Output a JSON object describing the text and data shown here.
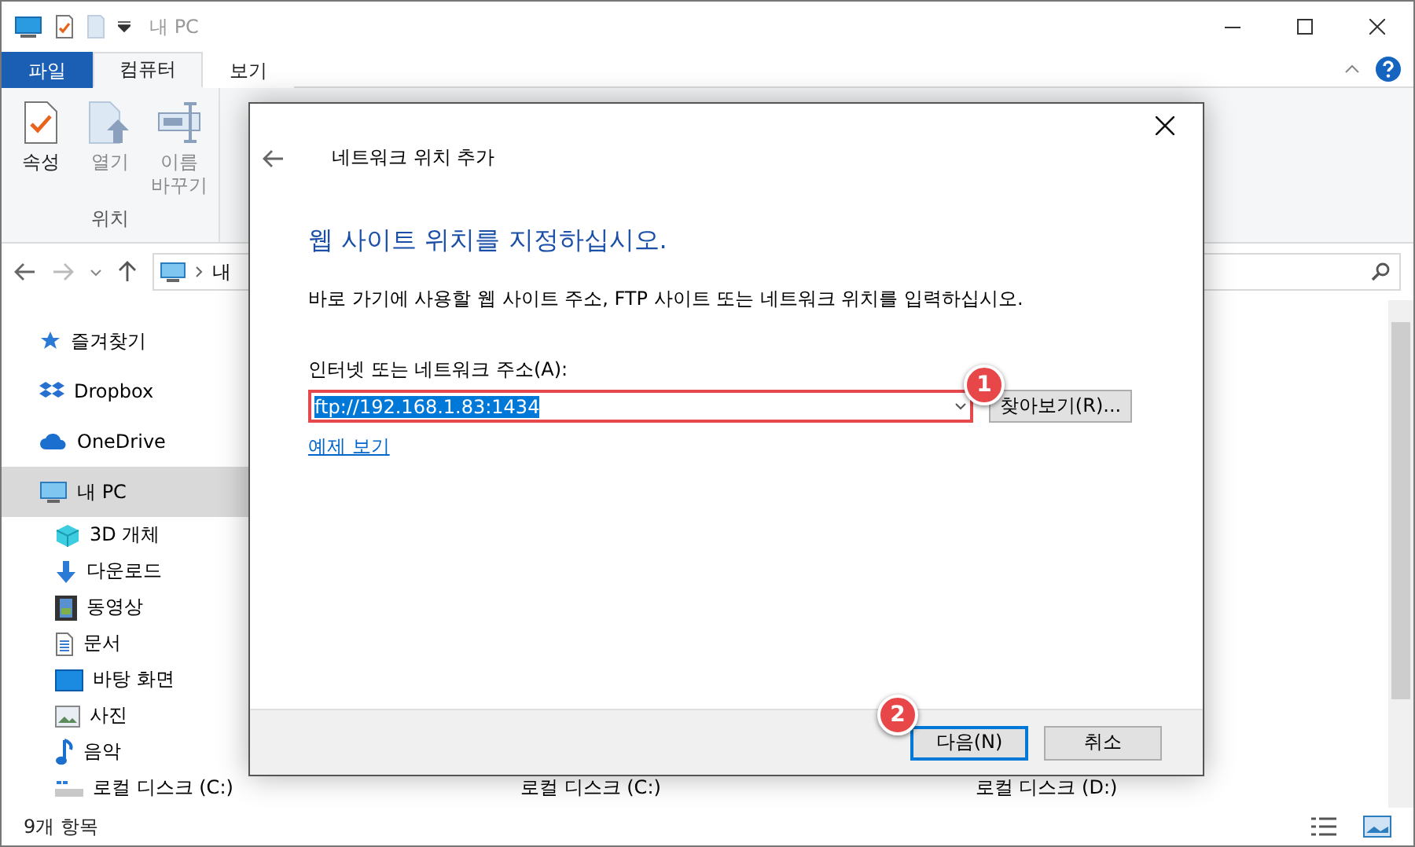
{
  "window": {
    "title": "내 PC"
  },
  "ribbon_tabs": [
    {
      "label": "파일",
      "kind": "file",
      "selected": false
    },
    {
      "label": "컴퓨터",
      "kind": "tab",
      "selected": true
    },
    {
      "label": "보기",
      "kind": "tab",
      "selected": false
    }
  ],
  "ribbon": {
    "buttons": [
      {
        "label": "속성",
        "disabled": false
      },
      {
        "label": "열기",
        "disabled": true
      },
      {
        "label": "이름 바꾸기",
        "disabled": true
      }
    ],
    "group_label": "위치"
  },
  "address_bar": {
    "crumb": "내"
  },
  "sidebar": {
    "items": [
      {
        "label": "즐겨찾기",
        "selected": false
      },
      {
        "label": "Dropbox",
        "selected": false
      },
      {
        "label": "OneDrive",
        "selected": false
      },
      {
        "label": "내 PC",
        "selected": true,
        "children": [
          {
            "label": "3D 개체",
            "selected": false
          },
          {
            "label": "다운로드",
            "selected": false
          },
          {
            "label": "동영상",
            "selected": false
          },
          {
            "label": "문서",
            "selected": false
          },
          {
            "label": "바탕 화면",
            "selected": false
          },
          {
            "label": "사진",
            "selected": false
          },
          {
            "label": "음악",
            "selected": false
          },
          {
            "label": "로컬 디스크 (C:)",
            "selected": false
          }
        ]
      }
    ]
  },
  "drives": [
    {
      "label": "로컬 디스크 (C:)"
    },
    {
      "label": "로컬 디스크 (D:)"
    }
  ],
  "status_bar": {
    "count": "9개 항목"
  },
  "dialog": {
    "title": "네트워크 위치 추가",
    "heading": "웹 사이트 위치를 지정하십시오.",
    "description": "바로 가기에 사용할 웹 사이트 주소, FTP 사이트 또는 네트워크 위치를 입력하십시오.",
    "field_label": "인터넷 또는 네트워크 주소(A):",
    "field_value": "ftp://192.168.1.83:1434",
    "browse": "찾아보기(R)...",
    "link": "예제 보기",
    "buttons": [
      {
        "label": "다음(N)",
        "default": true
      },
      {
        "label": "취소",
        "default": false
      }
    ]
  },
  "annotations": [
    {
      "label": "1"
    },
    {
      "label": "2"
    }
  ]
}
